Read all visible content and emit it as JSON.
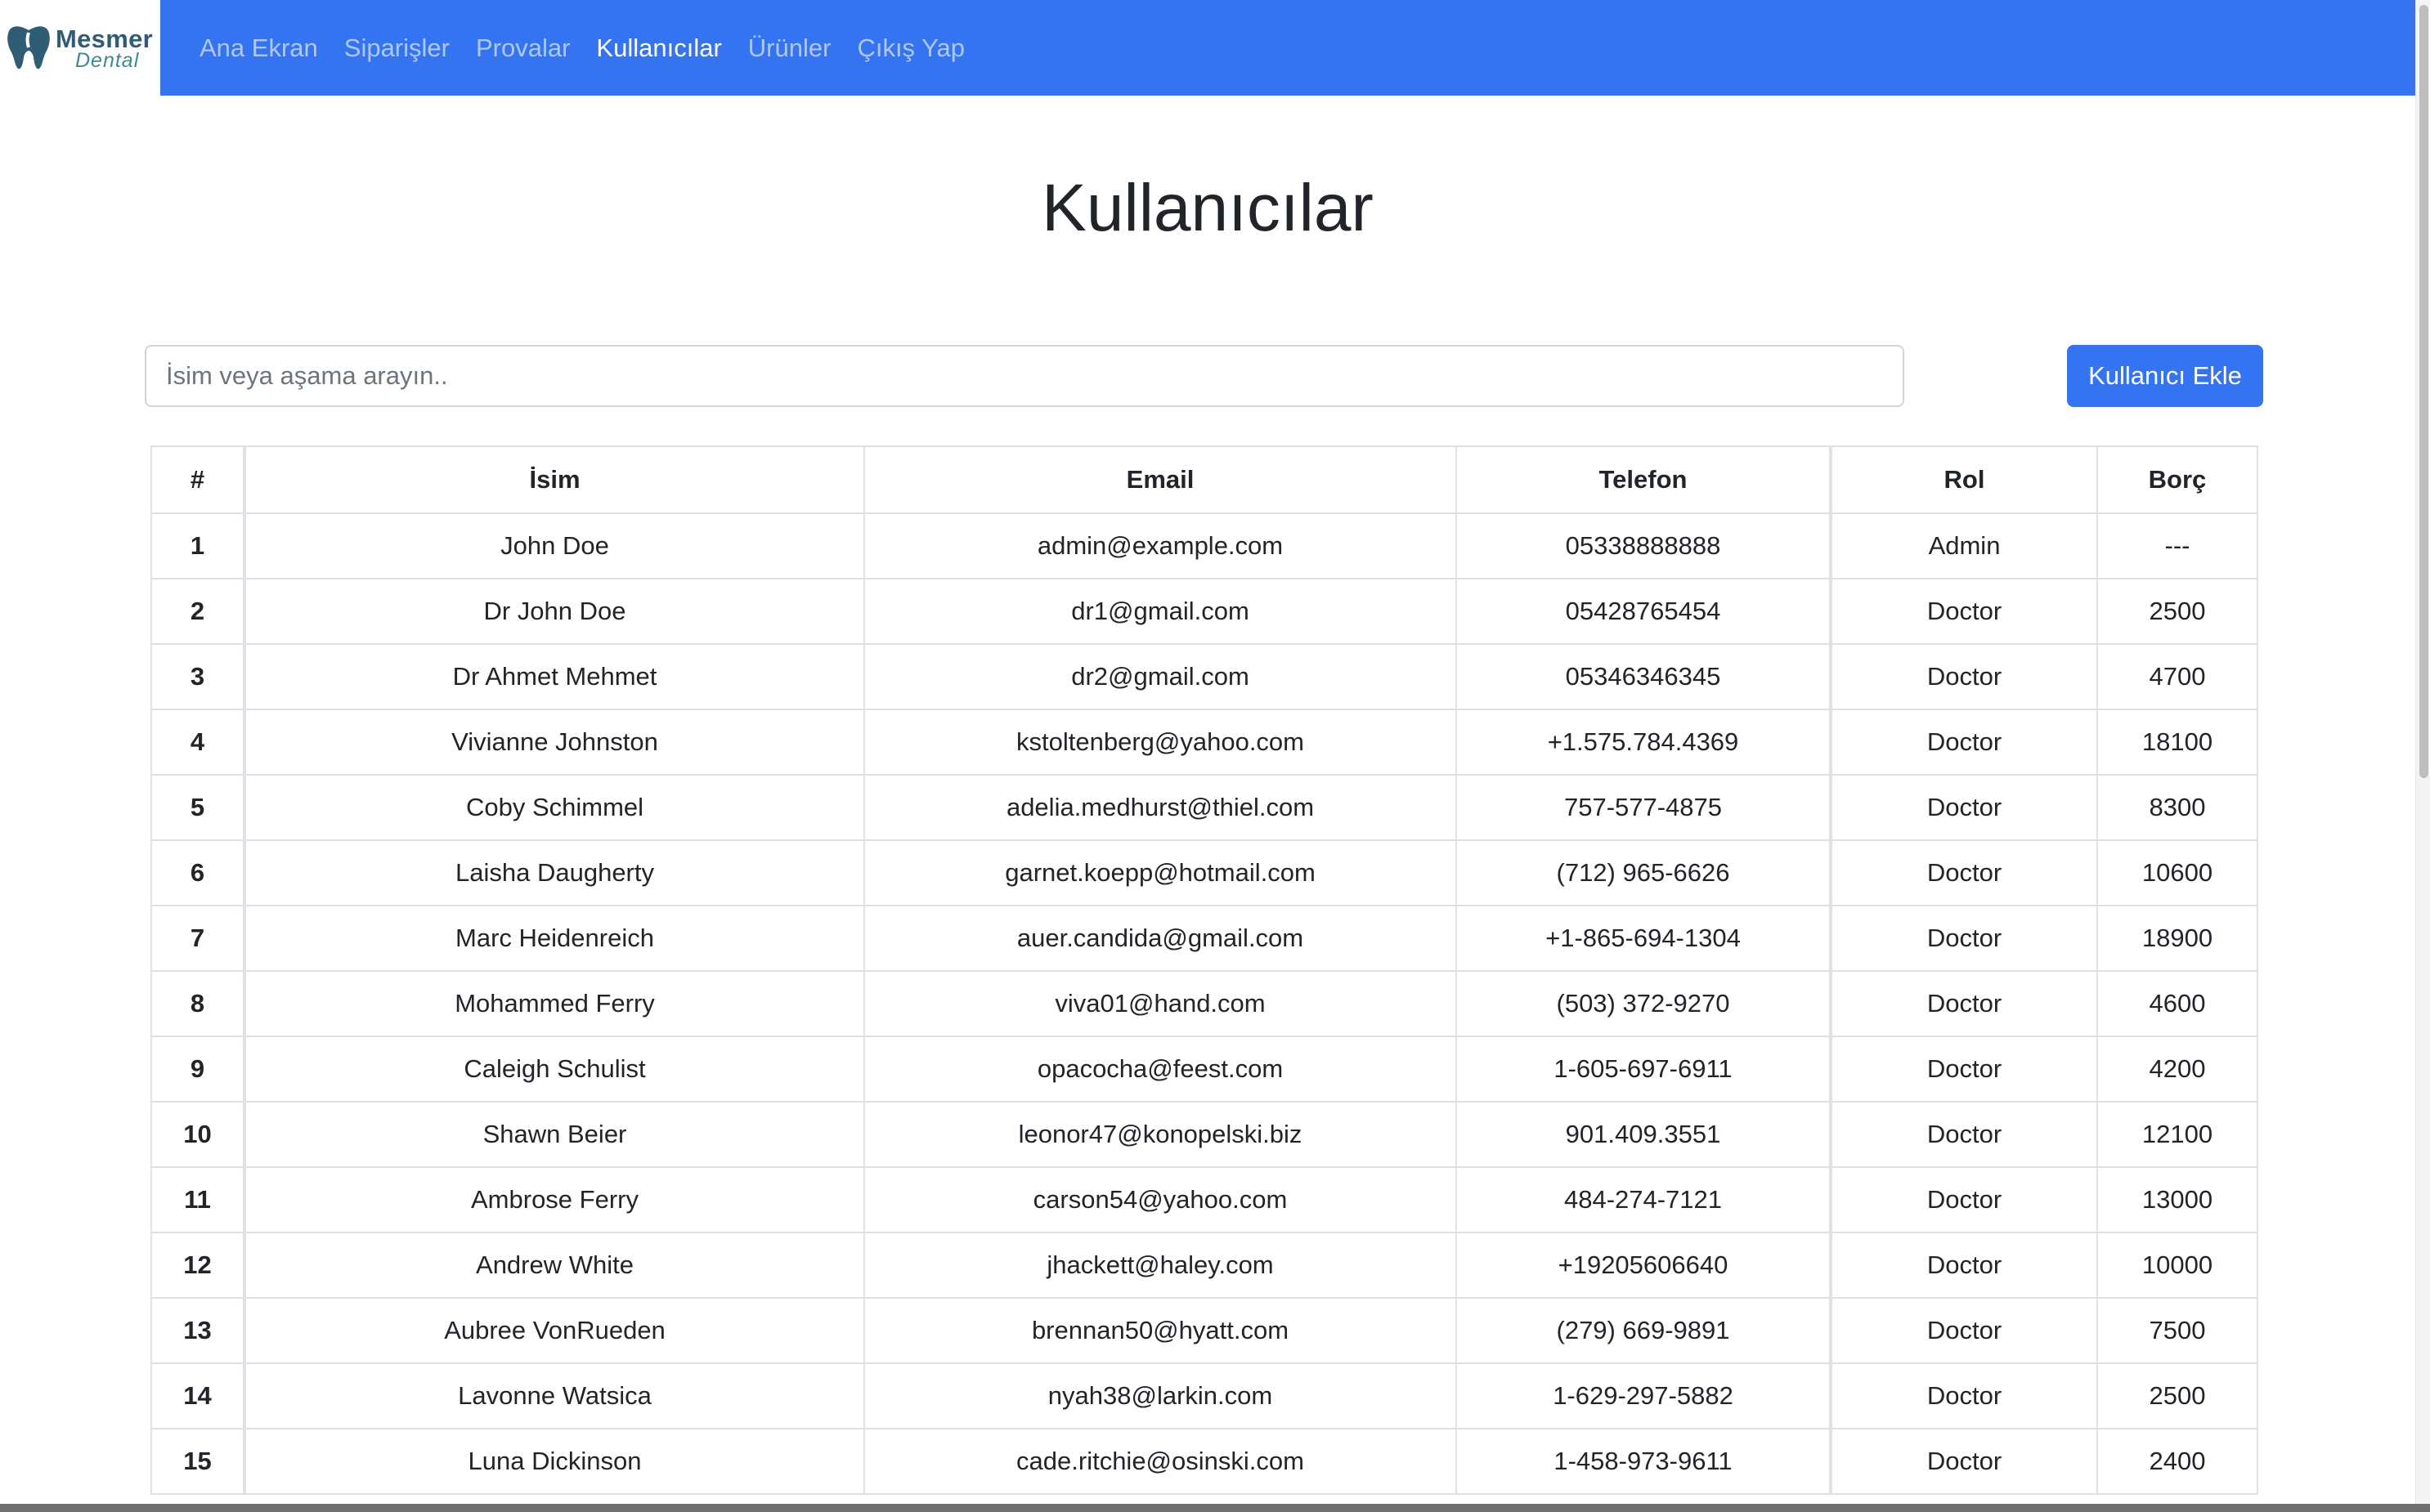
{
  "brand": {
    "word1": "Mesmer",
    "word2": "Dental",
    "icon": "tooth-logo-icon"
  },
  "nav": {
    "items": [
      {
        "label": "Ana Ekran",
        "active": false
      },
      {
        "label": "Siparişler",
        "active": false
      },
      {
        "label": "Provalar",
        "active": false
      },
      {
        "label": "Kullanıcılar",
        "active": true
      },
      {
        "label": "Ürünler",
        "active": false
      },
      {
        "label": "Çıkış Yap",
        "active": false
      }
    ]
  },
  "page": {
    "title": "Kullanıcılar"
  },
  "search": {
    "placeholder": "İsim veya aşama arayın..",
    "value": ""
  },
  "actions": {
    "add_user_label": "Kullanıcı Ekle"
  },
  "colors": {
    "accent": "#3574f0",
    "border": "#dee2e6"
  },
  "table": {
    "headers": [
      "#",
      "İsim",
      "Email",
      "Telefon",
      "Rol",
      "Borç"
    ],
    "rows": [
      [
        "1",
        "John Doe",
        "admin@example.com",
        "05338888888",
        "Admin",
        "---"
      ],
      [
        "2",
        "Dr John Doe",
        "dr1@gmail.com",
        "05428765454",
        "Doctor",
        "2500"
      ],
      [
        "3",
        "Dr Ahmet Mehmet",
        "dr2@gmail.com",
        "05346346345",
        "Doctor",
        "4700"
      ],
      [
        "4",
        "Vivianne Johnston",
        "kstoltenberg@yahoo.com",
        "+1.575.784.4369",
        "Doctor",
        "18100"
      ],
      [
        "5",
        "Coby Schimmel",
        "adelia.medhurst@thiel.com",
        "757-577-4875",
        "Doctor",
        "8300"
      ],
      [
        "6",
        "Laisha Daugherty",
        "garnet.koepp@hotmail.com",
        "(712) 965-6626",
        "Doctor",
        "10600"
      ],
      [
        "7",
        "Marc Heidenreich",
        "auer.candida@gmail.com",
        "+1-865-694-1304",
        "Doctor",
        "18900"
      ],
      [
        "8",
        "Mohammed Ferry",
        "viva01@hand.com",
        "(503) 372-9270",
        "Doctor",
        "4600"
      ],
      [
        "9",
        "Caleigh Schulist",
        "opacocha@feest.com",
        "1-605-697-6911",
        "Doctor",
        "4200"
      ],
      [
        "10",
        "Shawn Beier",
        "leonor47@konopelski.biz",
        "901.409.3551",
        "Doctor",
        "12100"
      ],
      [
        "11",
        "Ambrose Ferry",
        "carson54@yahoo.com",
        "484-274-7121",
        "Doctor",
        "13000"
      ],
      [
        "12",
        "Andrew White",
        "jhackett@haley.com",
        "+19205606640",
        "Doctor",
        "10000"
      ],
      [
        "13",
        "Aubree VonRueden",
        "brennan50@hyatt.com",
        "(279) 669-9891",
        "Doctor",
        "7500"
      ],
      [
        "14",
        "Lavonne Watsica",
        "nyah38@larkin.com",
        "1-629-297-5882",
        "Doctor",
        "2500"
      ],
      [
        "15",
        "Luna Dickinson",
        "cade.ritchie@osinski.com",
        "1-458-973-9611",
        "Doctor",
        "2400"
      ]
    ]
  }
}
